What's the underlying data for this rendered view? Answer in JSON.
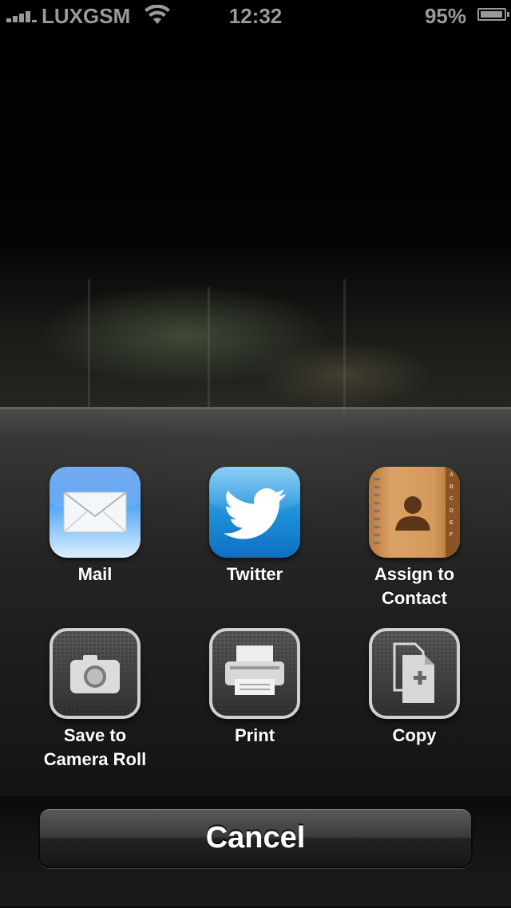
{
  "status_bar": {
    "carrier": "LUXGSM",
    "time": "12:32",
    "battery_percent": "95%",
    "signal_bars": 5,
    "battery_level": 0.95
  },
  "share_sheet": {
    "actions": [
      {
        "label": "Mail",
        "icon": "mail-icon"
      },
      {
        "label": "Twitter",
        "icon": "twitter-icon"
      },
      {
        "label": "Assign to\nContact",
        "icon": "contacts-icon"
      },
      {
        "label": "Save to\nCamera Roll",
        "icon": "camera-icon"
      },
      {
        "label": "Print",
        "icon": "printer-icon"
      },
      {
        "label": "Copy",
        "icon": "copy-icon"
      }
    ],
    "cancel_label": "Cancel"
  },
  "colors": {
    "status_text": "#9a9a9a",
    "twitter_blue": "#1c8ed8",
    "mail_blue": "#2c7ee8",
    "contacts_tan": "#d49a5b"
  }
}
